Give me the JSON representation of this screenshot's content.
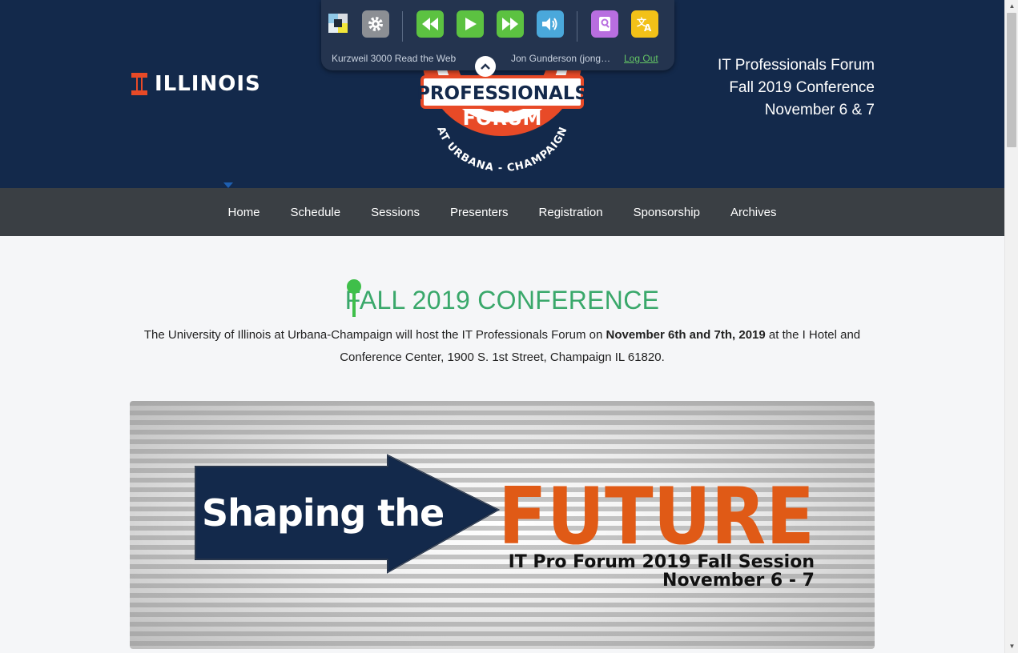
{
  "header": {
    "brand": "ILLINOIS",
    "event_line1": "IT Professionals Forum",
    "event_line2": "Fall 2019 Conference",
    "event_line3": "November 6 & 7",
    "badge_line1": "PROFESSIONALS",
    "badge_line2": "FORUM",
    "badge_arc": "AT URBANA - CHAMPAIGN"
  },
  "nav": {
    "items": [
      {
        "label": "Home",
        "active": true
      },
      {
        "label": "Schedule"
      },
      {
        "label": "Sessions"
      },
      {
        "label": "Presenters"
      },
      {
        "label": "Registration"
      },
      {
        "label": "Sponsorship"
      },
      {
        "label": "Archives"
      }
    ]
  },
  "main": {
    "title": "FALL 2019 CONFERENCE",
    "intro_before": "The University of Illinois at Urbana-Champaign will host the IT Professionals Forum on ",
    "intro_bold": "November 6th and 7th, 2019",
    "intro_after": " at the I Hotel and Conference Center, 1900 S. 1st Street, Champaign IL 61820.",
    "banner": {
      "text_left": "Shaping the",
      "text_big": "FUTURE",
      "subtitle": "IT Pro Forum 2019 Fall Session",
      "dates": "November 6 - 7"
    }
  },
  "kurzweil": {
    "app_name": "Kurzweil 3000 Read the Web",
    "user": "Jon Gunderson (jong…",
    "logout": "Log Out",
    "icons": [
      "kurzweil-logo-icon",
      "settings-gear-icon",
      "rewind-icon",
      "play-icon",
      "fast-forward-icon",
      "volume-icon",
      "dictionary-icon",
      "translate-icon"
    ]
  },
  "colors": {
    "header_bg": "#13294b",
    "nav_bg": "#3a3f44",
    "illinois_orange": "#e84a27",
    "title_green": "#3aa86b",
    "toolbar_bg": "#24344f",
    "green_btn": "#5cc241",
    "blue_btn": "#4aa8db",
    "purple_btn": "#b86ee0",
    "yellow_btn": "#f2c118"
  }
}
